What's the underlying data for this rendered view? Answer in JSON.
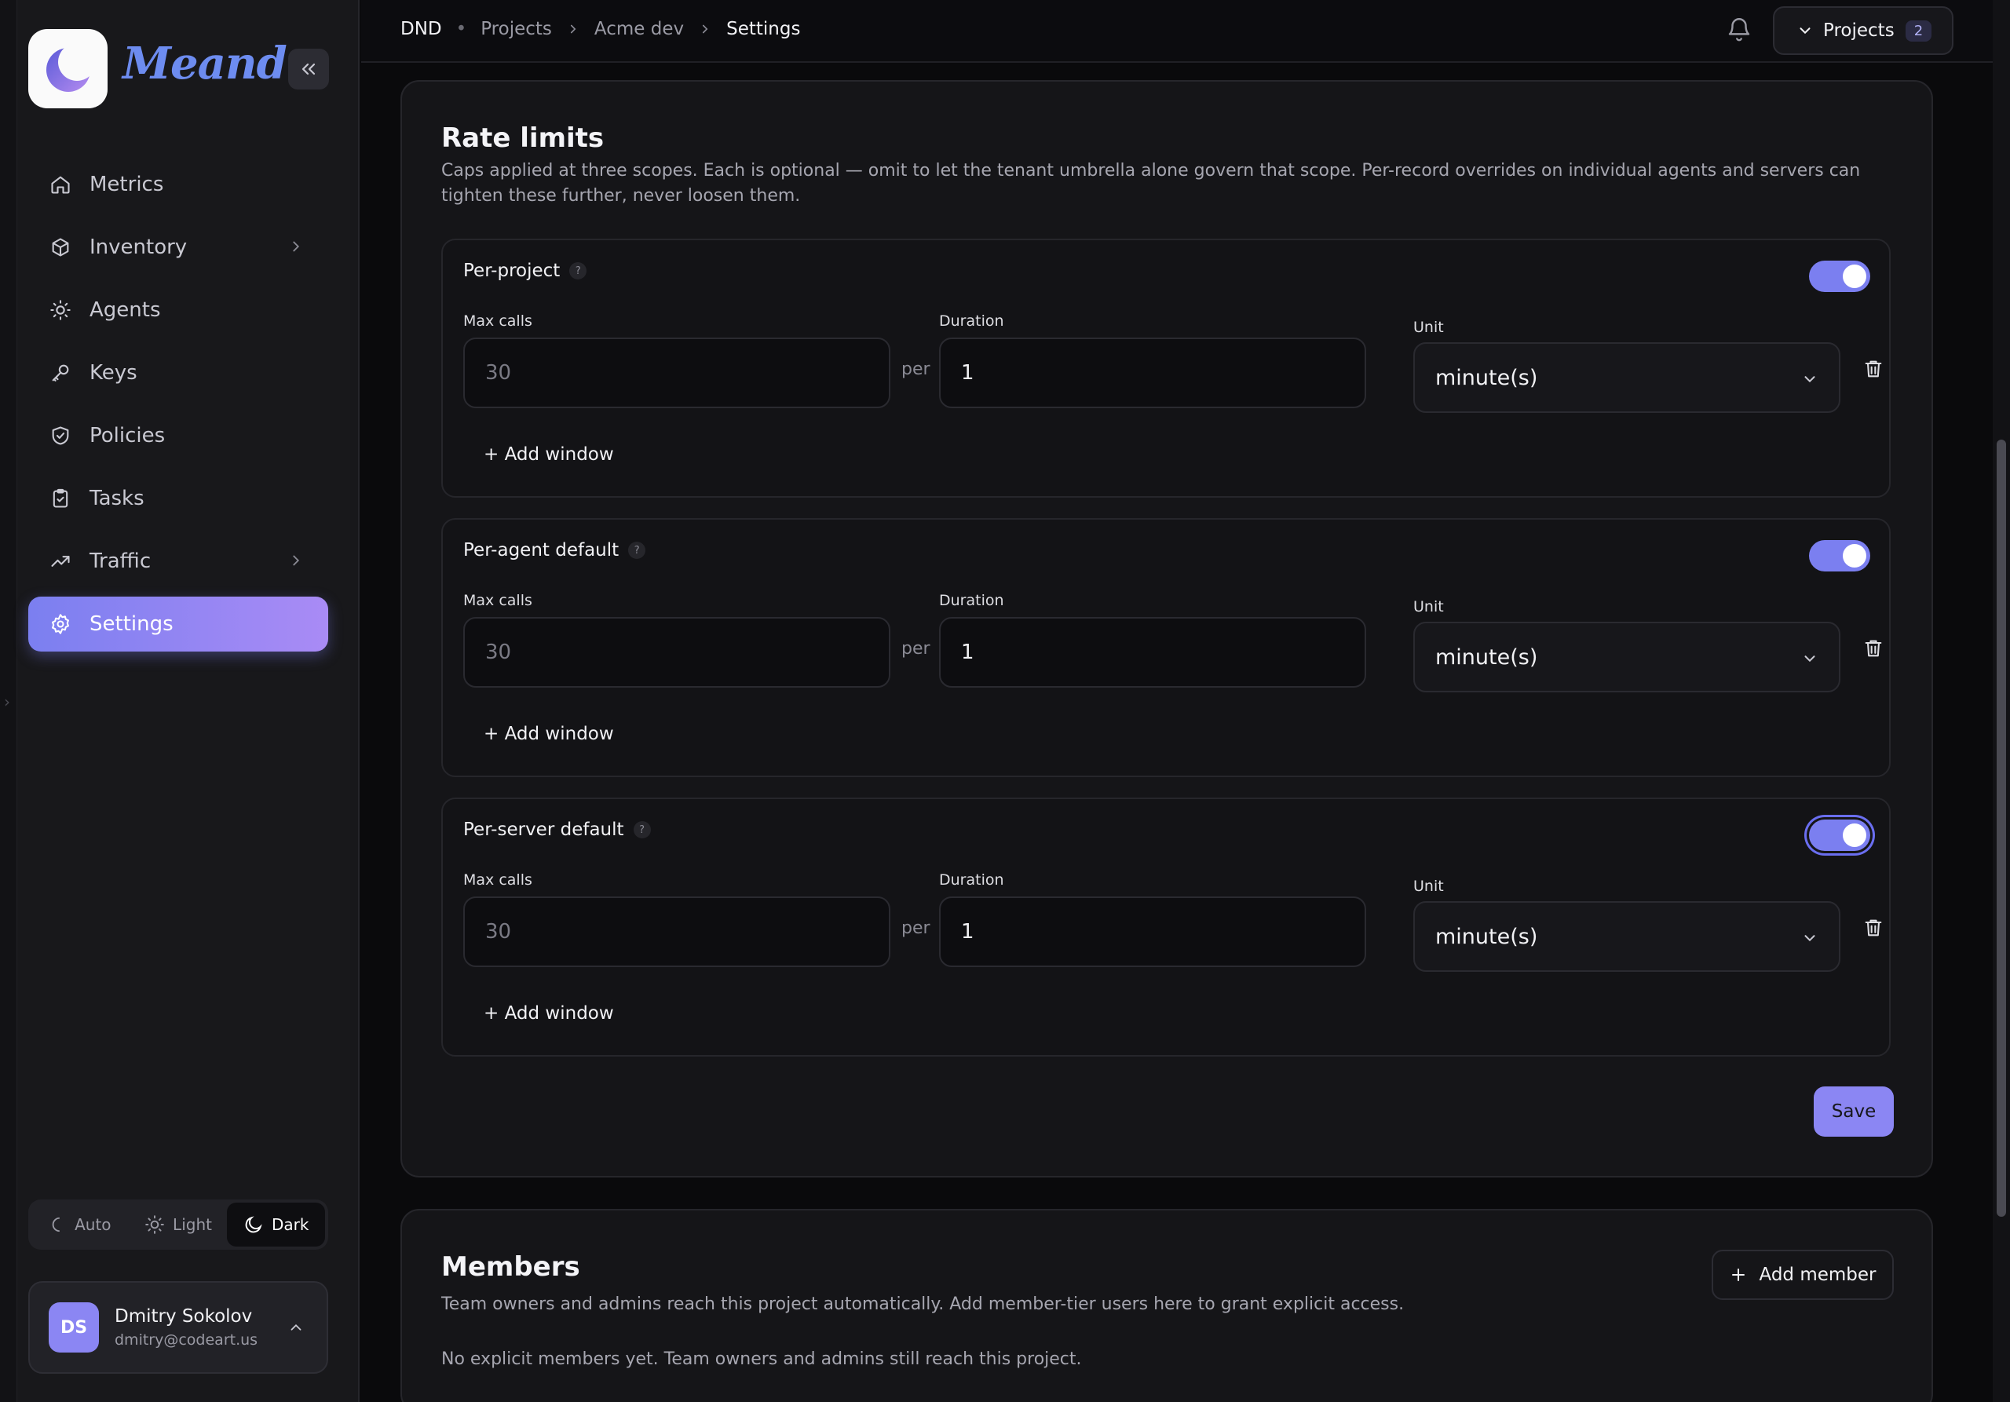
{
  "brand": {
    "name": "Meandr"
  },
  "nav": {
    "items": [
      {
        "label": "Metrics",
        "icon": "home-icon"
      },
      {
        "label": "Inventory",
        "icon": "box-icon"
      },
      {
        "label": "Agents",
        "icon": "lightbulb-icon"
      },
      {
        "label": "Keys",
        "icon": "key-icon"
      },
      {
        "label": "Policies",
        "icon": "shield-check-icon"
      },
      {
        "label": "Tasks",
        "icon": "clipboard-check-icon"
      },
      {
        "label": "Traffic",
        "icon": "trending-up-icon"
      },
      {
        "label": "Settings",
        "icon": "gear-icon"
      }
    ],
    "active": "Settings"
  },
  "theme": {
    "options": [
      "Auto",
      "Light",
      "Dark"
    ],
    "selected": "Dark"
  },
  "user": {
    "initials": "DS",
    "name": "Dmitry Sokolov",
    "email": "dmitry@codeart.us"
  },
  "header": {
    "breadcrumb": [
      "DND",
      "Projects",
      "Acme dev",
      "Settings"
    ],
    "projects_label": "Projects",
    "projects_count": "2"
  },
  "rate_limits": {
    "title": "Rate limits",
    "description": "Caps applied at three scopes. Each is optional — omit to let the tenant umbrella alone govern that scope. Per-record overrides on individual agents and servers can tighten these further, never loosen them.",
    "labels": {
      "max_calls": "Max calls",
      "duration": "Duration",
      "unit": "Unit",
      "per": "per",
      "add_window": "+ Add window",
      "help": "?"
    },
    "scopes": [
      {
        "title": "Per-project",
        "enabled": true,
        "max_calls_placeholder": "30",
        "duration": "1",
        "unit": "minute(s)"
      },
      {
        "title": "Per-agent default",
        "enabled": true,
        "max_calls_placeholder": "30",
        "duration": "1",
        "unit": "minute(s)"
      },
      {
        "title": "Per-server default",
        "enabled": true,
        "max_calls_placeholder": "30",
        "duration": "1",
        "unit": "minute(s)"
      }
    ],
    "save_label": "Save"
  },
  "members": {
    "title": "Members",
    "description": "Team owners and admins reach this project automatically. Add member-tier users here to grant explicit access.",
    "add_label": "Add member",
    "empty_text": "No explicit members yet. Team owners and admins still reach this project."
  },
  "colors": {
    "accent": "#7b7ff0",
    "accent_light": "#a98bf5",
    "bg": "#0a0a0c",
    "card": "#151518"
  }
}
